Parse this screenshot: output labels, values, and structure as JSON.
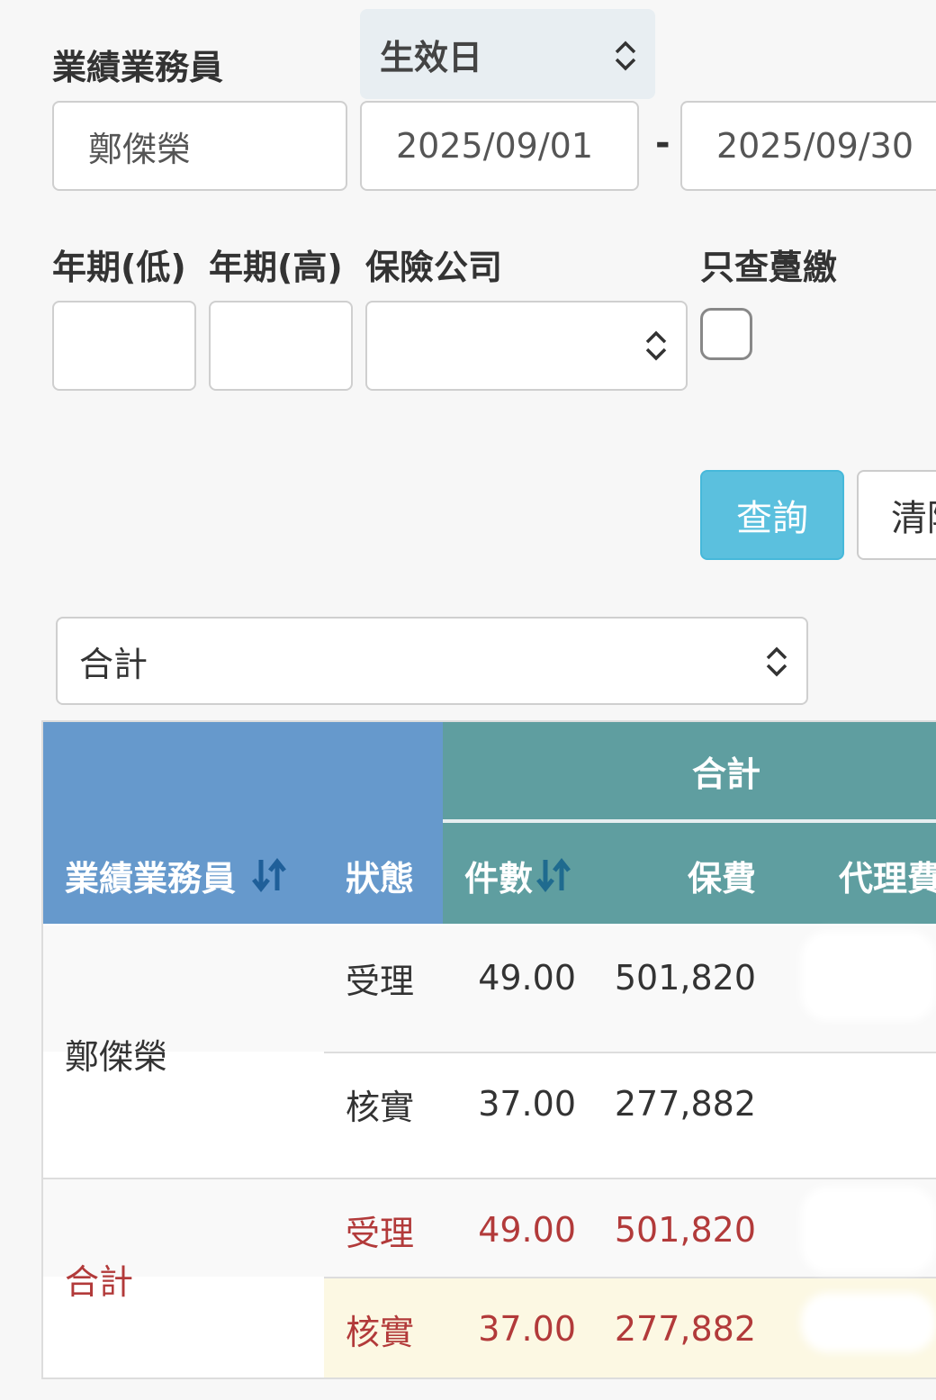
{
  "filters": {
    "salesperson_label": "業績業務員",
    "salesperson_value": "鄭傑榮",
    "date_type_selected": "生效日",
    "date_from": "2025/09/01",
    "date_separator": "-",
    "date_to": "2025/09/30",
    "year_low_label": "年期(低)",
    "year_high_label": "年期(高)",
    "insurer_label": "保險公司",
    "only_first_premium_label": "只查躉繳"
  },
  "buttons": {
    "query": "查詢",
    "clear": "清除"
  },
  "summary_select": {
    "selected": "合計"
  },
  "table": {
    "group_header": "合計",
    "columns": {
      "salesperson": "業績業務員",
      "status": "狀態",
      "count": "件數",
      "premium": "保費",
      "agency_fee": "代理費"
    },
    "rows": [
      {
        "name": "鄭傑榮",
        "lines": [
          {
            "status": "受理",
            "count": "49.00",
            "premium": "501,820"
          },
          {
            "status": "核實",
            "count": "37.00",
            "premium": "277,882"
          }
        ]
      }
    ],
    "total": {
      "name": "合計",
      "lines": [
        {
          "status": "受理",
          "count": "49.00",
          "premium": "501,820"
        },
        {
          "status": "核實",
          "count": "37.00",
          "premium": "277,882"
        }
      ]
    }
  },
  "colors": {
    "header_blue": "#6699cc",
    "header_teal": "#5f9ea0",
    "query_button": "#5bc0de",
    "total_text": "#b23a3a",
    "highlight_row": "#fcf8e3"
  }
}
